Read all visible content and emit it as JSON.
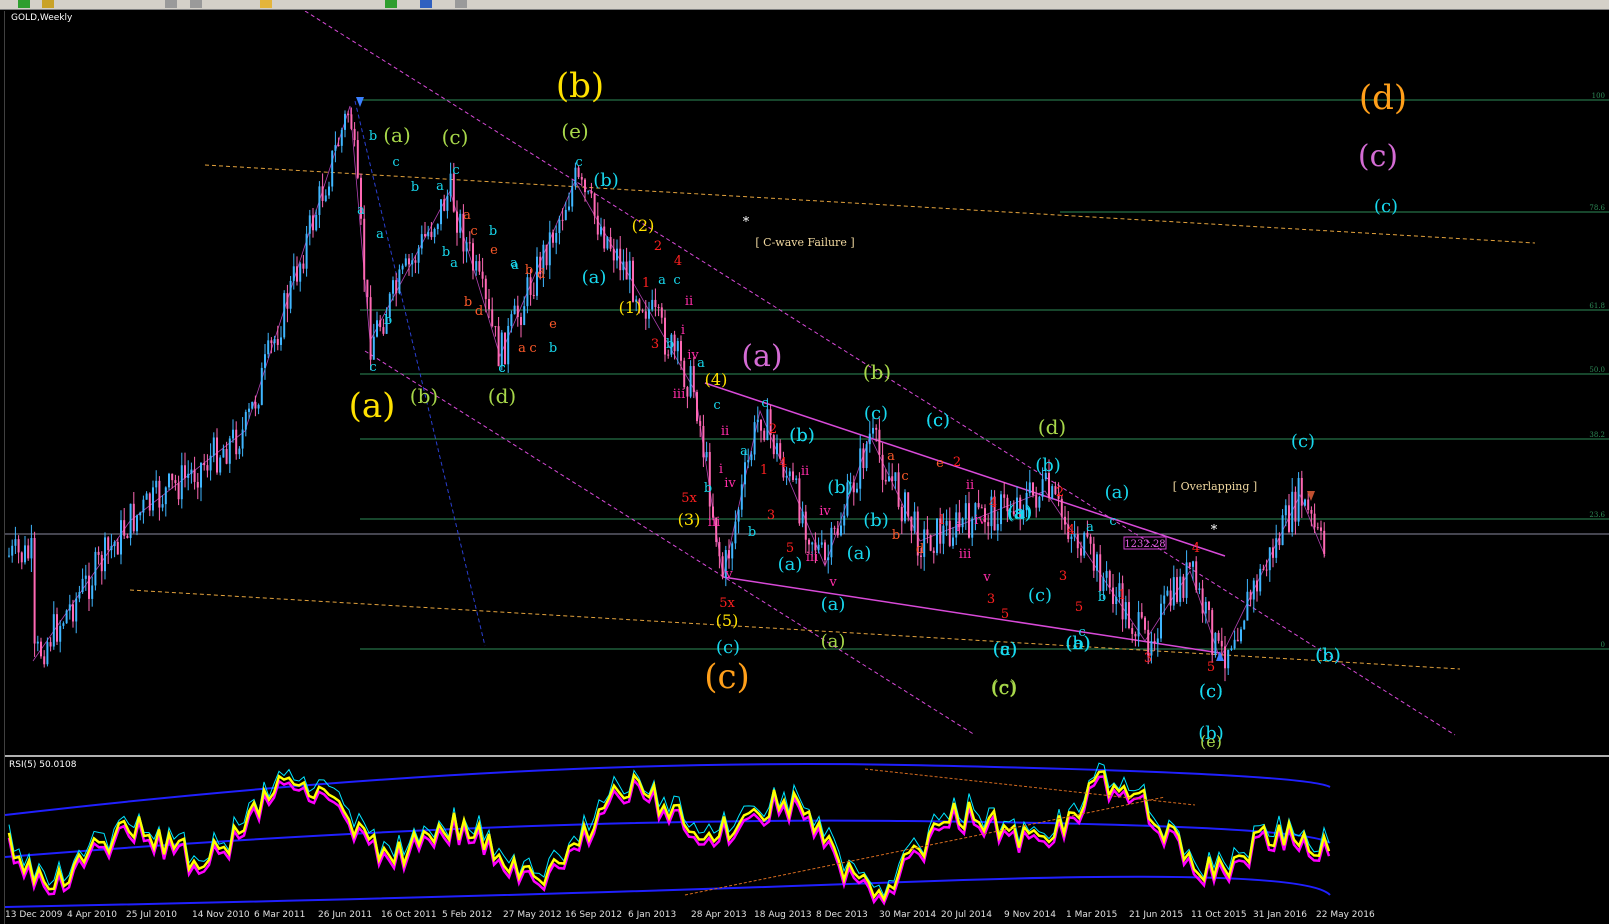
{
  "toolbar": {
    "icons": [
      "new-chart-icon",
      "profiles-icon",
      "zoom-in-icon",
      "zoom-out-icon",
      "line-icon",
      "crosshair-icon",
      "period-icon",
      "template-icon"
    ]
  },
  "chart": {
    "symbol_title": "GOLD,Weekly",
    "price_marker": "1232.28",
    "fib_labels": [
      "100",
      "78.6",
      "61.8",
      "50.0",
      "38.2",
      "23.6",
      "0"
    ],
    "notes": {
      "cwave": "[ C-wave Failure ]",
      "overlap": "[ Overlapping ]",
      "star": "*"
    },
    "colors": {
      "bull": "#3fb6ff",
      "bear": "#ff69b4",
      "fib": "#2e8b57",
      "channel": "#d84ad8",
      "trend": "#e3a23c"
    }
  },
  "rsi": {
    "title": "RSI(5) 50.0108",
    "colors": {
      "main": "#ffff00",
      "signal": "#ff00ff",
      "fast": "#00e5ff",
      "band": "#2020ff"
    }
  },
  "time_axis": {
    "labels": [
      "13 Dec 2009",
      "4 Apr 2010",
      "25 Jul 2010",
      "14 Nov 2010",
      "6 Mar 2011",
      "26 Jun 2011",
      "16 Oct 2011",
      "5 Feb 2012",
      "27 May 2012",
      "16 Sep 2012",
      "6 Jan 2013",
      "28 Apr 2013",
      "18 Aug 2013",
      "8 Dec 2013",
      "30 Mar 2014",
      "20 Jul 2014",
      "9 Nov 2014",
      "1 Mar 2015",
      "21 Jun 2015",
      "11 Oct 2015",
      "31 Jan 2016",
      "22 May 2016"
    ]
  },
  "wave_labels": [
    {
      "t": "(b)",
      "c": "#ffe100",
      "s": 34
    },
    {
      "t": "(d)",
      "c": "#ff9f1a",
      "s": 34
    },
    {
      "t": "(c)",
      "c": "#d46bd4",
      "s": 30
    },
    {
      "t": "(c)",
      "c": "#18d8ee",
      "s": 18
    },
    {
      "t": "(a)",
      "c": "#ffe100",
      "s": 34
    },
    {
      "t": "(c)",
      "c": "#ff9f1a",
      "s": 34
    },
    {
      "t": "(a)",
      "c": "#d46bd4",
      "s": 30
    },
    {
      "t": "(a)",
      "c": "#a8d84a",
      "s": 20
    },
    {
      "t": "(c)",
      "c": "#a8d84a",
      "s": 20
    },
    {
      "t": "(e)",
      "c": "#a8d84a",
      "s": 20
    },
    {
      "t": "(b)",
      "c": "#a8d84a",
      "s": 20
    },
    {
      "t": "(d)",
      "c": "#a8d84a",
      "s": 20
    },
    {
      "t": "(b)",
      "c": "#a8d84a",
      "s": 20
    },
    {
      "t": "(d)",
      "c": "#a8d84a",
      "s": 20
    },
    {
      "t": "(a)",
      "c": "#a8d84a",
      "s": 18
    },
    {
      "t": "(c)",
      "c": "#a8d84a",
      "s": 20
    },
    {
      "t": "(b)",
      "c": "#18d8ee",
      "s": 18
    },
    {
      "t": "(a)",
      "c": "#18d8ee",
      "s": 18
    },
    {
      "t": "(2)",
      "c": "#ffe100",
      "s": 16
    },
    {
      "t": "(1)",
      "c": "#ffe100",
      "s": 16
    },
    {
      "t": "(4)",
      "c": "#ffe100",
      "s": 16
    },
    {
      "t": "(3)",
      "c": "#ffe100",
      "s": 16
    },
    {
      "t": "(5)",
      "c": "#ffe100",
      "s": 16
    },
    {
      "t": "(c)",
      "c": "#18d8ee",
      "s": 18
    },
    {
      "t": "(b)",
      "c": "#18d8ee",
      "s": 18
    },
    {
      "t": "(c)",
      "c": "#18d8ee",
      "s": 18
    },
    {
      "t": "(b)",
      "c": "#18d8ee",
      "s": 18
    },
    {
      "t": "(a)",
      "c": "#18d8ee",
      "s": 18
    },
    {
      "t": "(b)",
      "c": "#18d8ee",
      "s": 18
    },
    {
      "t": "(a)",
      "c": "#18d8ee",
      "s": 18
    },
    {
      "t": "(b)",
      "c": "#18d8ee",
      "s": 18
    },
    {
      "t": "(c)",
      "c": "#18d8ee",
      "s": 18
    },
    {
      "t": "(c)",
      "c": "#18d8ee",
      "s": 18
    },
    {
      "t": "(a)",
      "c": "#18d8ee",
      "s": 18
    },
    {
      "t": "(b)",
      "c": "#18d8ee",
      "s": 18
    },
    {
      "t": "(c)",
      "c": "#18d8ee",
      "s": 18
    },
    {
      "t": "(a)",
      "c": "#18d8ee",
      "s": 18
    },
    {
      "t": "(b)",
      "c": "#18d8ee",
      "s": 18
    },
    {
      "t": "(a)",
      "c": "#18d8ee",
      "s": 18
    },
    {
      "t": "(a)",
      "c": "#18d8ee",
      "s": 18
    },
    {
      "t": "(c)",
      "c": "#18d8ee",
      "s": 18
    },
    {
      "t": "(b)",
      "c": "#18d8ee",
      "s": 18
    },
    {
      "t": "(c)",
      "c": "#18d8ee",
      "s": 18
    },
    {
      "t": "(b)",
      "c": "#18d8ee",
      "s": 18
    },
    {
      "t": "(a)",
      "c": "#18d8ee",
      "s": 18
    },
    {
      "t": "(a)",
      "c": "#18d8ee",
      "s": 18
    },
    {
      "t": "(c)",
      "c": "#18d8ee",
      "s": 18
    },
    {
      "t": "(b)",
      "c": "#18d8ee",
      "s": 18
    },
    {
      "t": "(c)",
      "c": "#18d8ee",
      "s": 18
    },
    {
      "t": "(c)",
      "c": "#a8d84a",
      "s": 18
    },
    {
      "t": "(e)",
      "c": "#a8d84a",
      "s": 16
    }
  ],
  "small_labels": [
    {
      "t": "b",
      "c": "#18d8ee"
    },
    {
      "t": "a",
      "c": "#18d8ee"
    },
    {
      "t": "c",
      "c": "#18d8ee"
    },
    {
      "t": "b",
      "c": "#18d8ee"
    },
    {
      "t": "a",
      "c": "#18d8ee"
    },
    {
      "t": "c",
      "c": "#18d8ee"
    },
    {
      "t": "b",
      "c": "#18d8ee"
    },
    {
      "t": "a",
      "c": "#18d8ee"
    },
    {
      "t": "c",
      "c": "#18d8ee"
    },
    {
      "t": "a",
      "c": "#18d8ee"
    },
    {
      "t": "b",
      "c": "#18d8ee"
    },
    {
      "t": "c",
      "c": "#18d8ee"
    },
    {
      "t": "a",
      "c": "#ff5a2a"
    },
    {
      "t": "c",
      "c": "#ff5a2a"
    },
    {
      "t": "e",
      "c": "#ff5a2a"
    },
    {
      "t": "b",
      "c": "#ff5a2a"
    },
    {
      "t": "d",
      "c": "#ff5a2a"
    },
    {
      "t": "b",
      "c": "#ff5a2a"
    },
    {
      "t": "d",
      "c": "#ff5a2a"
    },
    {
      "t": "a",
      "c": "#ff5a2a"
    },
    {
      "t": "c",
      "c": "#ff5a2a"
    },
    {
      "t": "e",
      "c": "#ff5a2a"
    },
    {
      "t": "c",
      "c": "#18d8ee"
    },
    {
      "t": "a",
      "c": "#18d8ee"
    },
    {
      "t": "b",
      "c": "#18d8ee"
    },
    {
      "t": "a",
      "c": "#18d8ee"
    },
    {
      "t": "b",
      "c": "#18d8ee"
    },
    {
      "t": "c",
      "c": "#18d8ee"
    },
    {
      "t": "2",
      "c": "#ff2020"
    },
    {
      "t": "4",
      "c": "#ff2020"
    },
    {
      "t": "1",
      "c": "#ff2020"
    },
    {
      "t": "3",
      "c": "#ff2020"
    },
    {
      "t": "a",
      "c": "#18d8ee"
    },
    {
      "t": "c",
      "c": "#18d8ee"
    },
    {
      "t": "b",
      "c": "#18d8ee"
    },
    {
      "t": "ii",
      "c": "#ff2da8"
    },
    {
      "t": "i",
      "c": "#ff2da8"
    },
    {
      "t": "iv",
      "c": "#ff2da8"
    },
    {
      "t": "a",
      "c": "#18d8ee"
    },
    {
      "t": "iii",
      "c": "#ff2da8"
    },
    {
      "t": "c",
      "c": "#18d8ee"
    },
    {
      "t": "ii",
      "c": "#ff2da8"
    },
    {
      "t": "i",
      "c": "#ff2da8"
    },
    {
      "t": "5x",
      "c": "#ff2020"
    },
    {
      "t": "b",
      "c": "#18d8ee"
    },
    {
      "t": "iv",
      "c": "#ff2da8"
    },
    {
      "t": "iii",
      "c": "#ff2da8"
    },
    {
      "t": "b",
      "c": "#18d8ee"
    },
    {
      "t": "v",
      "c": "#ff2da8"
    },
    {
      "t": "5x",
      "c": "#ff2020"
    },
    {
      "t": "c",
      "c": "#18d8ee"
    },
    {
      "t": "a",
      "c": "#18d8ee"
    },
    {
      "t": "2",
      "c": "#ff2020"
    },
    {
      "t": "4",
      "c": "#ff2020"
    },
    {
      "t": "1",
      "c": "#ff2020"
    },
    {
      "t": "ii",
      "c": "#ff2da8"
    },
    {
      "t": "3",
      "c": "#ff2020"
    },
    {
      "t": "5",
      "c": "#ff2020"
    },
    {
      "t": "iv",
      "c": "#ff2da8"
    },
    {
      "t": "iii",
      "c": "#ff2da8"
    },
    {
      "t": "v",
      "c": "#ff2da8"
    },
    {
      "t": "a",
      "c": "#ff5a2a"
    },
    {
      "t": "c",
      "c": "#ff5a2a"
    },
    {
      "t": "e",
      "c": "#ff5a2a"
    },
    {
      "t": "b",
      "c": "#ff5a2a"
    },
    {
      "t": "d",
      "c": "#ff5a2a"
    },
    {
      "t": "2",
      "c": "#ff2020"
    },
    {
      "t": "1",
      "c": "#ff2020"
    },
    {
      "t": "ii",
      "c": "#ff2da8"
    },
    {
      "t": "i",
      "c": "#ff2da8"
    },
    {
      "t": "iv",
      "c": "#ff2da8"
    },
    {
      "t": "iii",
      "c": "#ff2da8"
    },
    {
      "t": "4",
      "c": "#ff2020"
    },
    {
      "t": "v",
      "c": "#ff2da8"
    },
    {
      "t": "3",
      "c": "#ff2020"
    },
    {
      "t": "5",
      "c": "#ff2020"
    },
    {
      "t": "2",
      "c": "#ff2020"
    },
    {
      "t": "4",
      "c": "#ff2020"
    },
    {
      "t": "3",
      "c": "#ff2020"
    },
    {
      "t": "5",
      "c": "#ff2020"
    },
    {
      "t": "a",
      "c": "#18d8ee"
    },
    {
      "t": "c",
      "c": "#18d8ee"
    },
    {
      "t": "b",
      "c": "#18d8ee"
    },
    {
      "t": "1",
      "c": "#ff2020"
    },
    {
      "t": "c",
      "c": "#18d8ee"
    },
    {
      "t": "3",
      "c": "#ff2020"
    },
    {
      "t": "4",
      "c": "#ff2020"
    },
    {
      "t": "5",
      "c": "#ff2020"
    },
    {
      "t": "*",
      "c": "#ffffff"
    },
    {
      "t": "*",
      "c": "#ffffff"
    }
  ]
}
